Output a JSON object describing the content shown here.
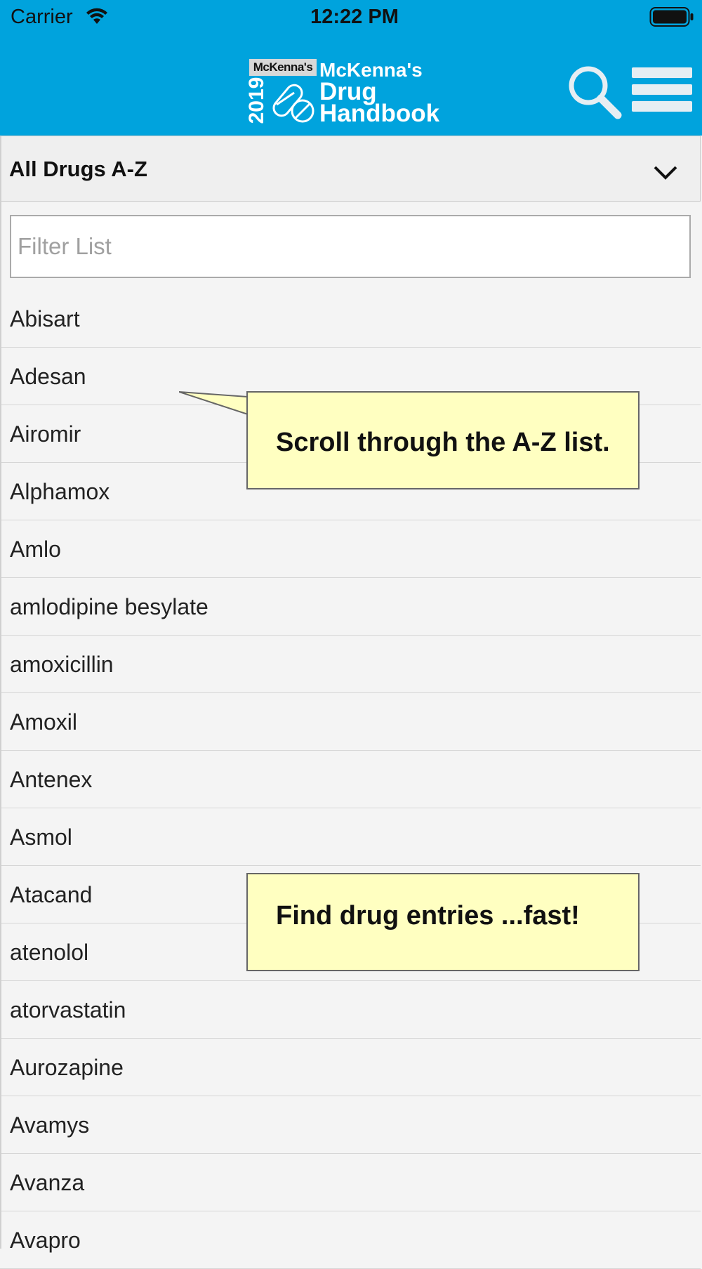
{
  "status_bar": {
    "carrier": "Carrier",
    "time": "12:22 PM",
    "icons": [
      "wifi-icon",
      "battery-icon"
    ]
  },
  "header": {
    "background_color": "#00a3dd",
    "logo": {
      "badge": "McKenna's",
      "year": "2019",
      "title_line1": "McKenna's",
      "title_line2": "Drug",
      "title_line3": "Handbook"
    },
    "icons": [
      "search-icon",
      "menu-icon"
    ]
  },
  "category_selector": {
    "selected": "All Drugs A-Z",
    "icon": "chevron-down-icon"
  },
  "filter": {
    "placeholder": "Filter List",
    "value": ""
  },
  "drug_list": [
    "Abisart",
    "Adesan",
    "Airomir",
    "Alphamox",
    "Amlo",
    "amlodipine besylate",
    "amoxicillin",
    "Amoxil",
    "Antenex",
    "Asmol",
    "Atacand",
    "atenolol",
    "atorvastatin",
    "Aurozapine",
    "Avamys",
    "Avanza",
    "Avapro"
  ],
  "callouts": [
    "Scroll through the A-Z list.",
    "Find drug entries ...fast!"
  ],
  "colors": {
    "callout_background": "#ffffc1",
    "list_background": "#f4f4f4"
  }
}
